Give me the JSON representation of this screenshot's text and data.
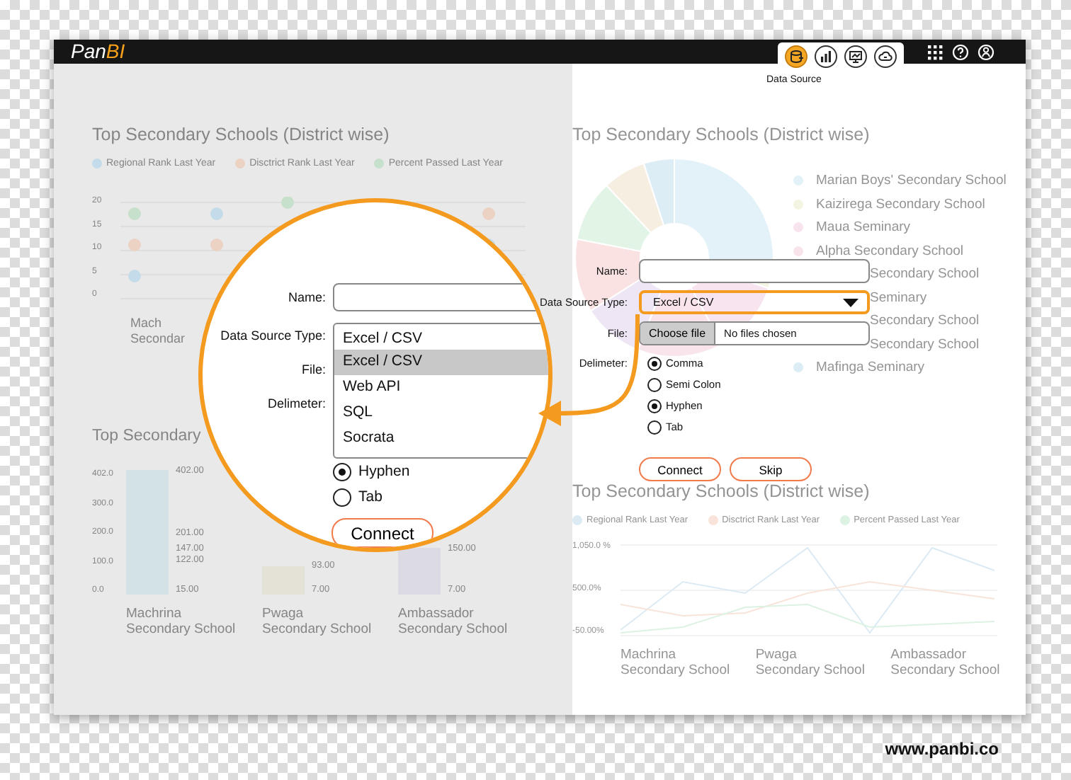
{
  "header": {
    "logo": {
      "main": "Pan",
      "accent": "BI"
    },
    "tools": [
      {
        "kind": "database",
        "selected": true
      },
      {
        "kind": "bar-chart",
        "selected": false
      },
      {
        "kind": "monitor",
        "selected": false
      },
      {
        "kind": "cloud",
        "selected": false
      }
    ],
    "tool_caption": "Data Source",
    "actions": [
      {
        "kind": "apps"
      },
      {
        "kind": "help"
      },
      {
        "kind": "user"
      }
    ]
  },
  "dashboard": {
    "left_top": {
      "title": "Top Secondary Schools (District wise)",
      "legend": [
        {
          "label": "Regional Rank Last Year",
          "color": "#c4dcea"
        },
        {
          "label": "Disctrict Rank Last Year",
          "color": "#ecd2c2"
        },
        {
          "label": "Percent Passed Last Year",
          "color": "#c6e0cc"
        }
      ],
      "yticks": [
        "20",
        "15",
        "10",
        "5",
        "0"
      ],
      "category_lines": [
        "Mach",
        "Secondar"
      ]
    },
    "left_bottom": {
      "title": "Top Secondary",
      "yticks": [
        "402.0",
        "300.0",
        "200.0",
        "100.0",
        "0.0"
      ],
      "bars": [
        {
          "category": [
            "Machrina",
            "Secondary School"
          ],
          "color": "#d3e2e4",
          "labels": [
            "402.00",
            "201.00",
            "147.00",
            "122.00",
            "15.00"
          ]
        },
        {
          "category": [
            "Pwaga",
            "Secondary School"
          ],
          "color": "#e4e2d6",
          "labels": [
            "93.00",
            "7.00"
          ]
        },
        {
          "category": [
            "Ambassador",
            "Secondary School"
          ],
          "color": "#dcdae2",
          "labels": [
            "150.00",
            "7.00"
          ]
        }
      ]
    },
    "right_top": {
      "title": "Top Secondary Schools (District wise)",
      "legend": [
        {
          "label": "Marian Boys' Secondary School",
          "color": "#e2f2f8",
          "kind": "full"
        },
        {
          "label": "Kaizirega Secondary School",
          "color": "#f4f4e2",
          "kind": "full"
        },
        {
          "label": "Maua Seminary",
          "color": "#f8e4ee",
          "kind": "full"
        },
        {
          "label": "Alpha Secondary School",
          "color": "#fae4ec",
          "kind": "full"
        },
        {
          "label": "Secondary School",
          "kind": "clipped"
        },
        {
          "label": "Seminary",
          "kind": "clipped"
        },
        {
          "label": "Secondary School",
          "kind": "clipped"
        },
        {
          "label": "Secondary School",
          "kind": "clipped"
        },
        {
          "label": "Mafinga Seminary",
          "color": "#dcedf6",
          "kind": "full"
        }
      ]
    },
    "right_bottom": {
      "title": "Top Secondary Schools (District wise)",
      "legend": [
        {
          "label": "Regional Rank Last Year",
          "color": "#dceaf4"
        },
        {
          "label": "Disctrict Rank Last Year",
          "color": "#f8e4da"
        },
        {
          "label": "Percent Passed Last Year",
          "color": "#dcf2e2"
        }
      ],
      "yticks": [
        "1,050.0 %",
        "500.0%",
        "-50.00%"
      ],
      "categories": [
        [
          "Machrina",
          "Secondary School"
        ],
        [
          "Pwaga",
          "Secondary School"
        ],
        [
          "Ambassador",
          "Secondary School"
        ]
      ]
    }
  },
  "form": {
    "name_label": "Name:",
    "type_label": "Data Source Type:",
    "type_value": "Excel / CSV",
    "file_label": "File:",
    "file_button": "Choose file",
    "file_status": "No files chosen",
    "delimiter_label": "Delimeter:",
    "delimiters": [
      {
        "label": "Comma",
        "selected": true
      },
      {
        "label": "Semi Colon",
        "selected": false
      },
      {
        "label": "Hyphen",
        "selected": true
      },
      {
        "label": "Tab",
        "selected": false
      }
    ],
    "buttons": [
      "Connect",
      "Skip"
    ]
  },
  "magnifier": {
    "name_label": "Name:",
    "type_label": "Data Source Type:",
    "file_label": "File:",
    "delimiter_label": "Delimeter:",
    "type_value": "Excel / CSV",
    "options": [
      {
        "label": "Excel / CSV",
        "selected": true
      },
      {
        "label": "Web API",
        "selected": false
      },
      {
        "label": "SQL",
        "selected": false
      },
      {
        "label": "Socrata",
        "selected": false
      }
    ],
    "delimiters": [
      {
        "label": "Hyphen",
        "selected": true
      },
      {
        "label": "Tab",
        "selected": false
      }
    ],
    "buttons": [
      "Connect"
    ]
  },
  "footer": {
    "url": "www.panbi.co"
  }
}
